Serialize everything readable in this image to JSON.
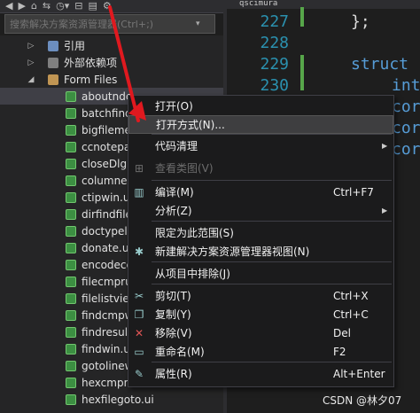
{
  "toolbar": {
    "sync_label": "⇆",
    "clock_label": "◷▾",
    "settings_label": "⚙"
  },
  "search": {
    "placeholder": "搜索解决方案资源管理器(Ctrl+;)"
  },
  "tree": {
    "ref_label": "引用",
    "external_label": "外部依赖项",
    "formfiles_label": "Form Files",
    "files": [
      "aboutndc",
      "batchfind",
      "bigfileme",
      "ccnotepa",
      "closeDlg.",
      "columnec",
      "ctipwin.ui",
      "dirfindfile",
      "doctypeli",
      "donate.ui",
      "encodecc",
      "filecmpru",
      "filelistview",
      "findcmpw",
      "findresult",
      "findwin.ui",
      "gotolinew",
      "hexcmpra",
      "hexfilegoto.ui"
    ]
  },
  "editor": {
    "tab_label": "qscimura",
    "line_numbers": [
      "227",
      "228",
      "229",
      "230"
    ],
    "code": [
      "};",
      "",
      "struct",
      "int"
    ],
    "side_fragments": [
      "cor",
      "cor",
      "cor"
    ]
  },
  "context_menu": {
    "items": [
      {
        "label": "打开(O)",
        "shortcut": "",
        "icon": "",
        "submenu": false,
        "disabled": false
      },
      {
        "label": "打开方式(N)...",
        "shortcut": "",
        "icon": "",
        "submenu": false,
        "disabled": false
      },
      {
        "label": "代码清理",
        "shortcut": "",
        "icon": "",
        "submenu": true,
        "disabled": false
      },
      {
        "label": "查看类图(V)",
        "shortcut": "",
        "icon": "class-diagram-icon",
        "submenu": false,
        "disabled": true
      },
      {
        "label": "编译(M)",
        "shortcut": "Ctrl+F7",
        "icon": "compile-icon",
        "submenu": false,
        "disabled": false
      },
      {
        "label": "分析(Z)",
        "shortcut": "",
        "icon": "",
        "submenu": true,
        "disabled": false
      },
      {
        "label": "限定为此范围(S)",
        "shortcut": "",
        "icon": "",
        "submenu": false,
        "disabled": false
      },
      {
        "label": "新建解决方案资源管理器视图(N)",
        "shortcut": "",
        "icon": "new-view-icon",
        "submenu": false,
        "disabled": false
      },
      {
        "label": "从项目中排除(J)",
        "shortcut": "",
        "icon": "",
        "submenu": false,
        "disabled": false
      },
      {
        "label": "剪切(T)",
        "shortcut": "Ctrl+X",
        "icon": "scissors-icon",
        "submenu": false,
        "disabled": false
      },
      {
        "label": "复制(Y)",
        "shortcut": "Ctrl+C",
        "icon": "copy-icon",
        "submenu": false,
        "disabled": false
      },
      {
        "label": "移除(V)",
        "shortcut": "Del",
        "icon": "remove-x-icon",
        "submenu": false,
        "disabled": false
      },
      {
        "label": "重命名(M)",
        "shortcut": "F2",
        "icon": "rename-icon",
        "submenu": false,
        "disabled": false
      },
      {
        "label": "属性(R)",
        "shortcut": "Alt+Enter",
        "icon": "wrench-icon",
        "submenu": false,
        "disabled": false
      }
    ]
  },
  "watermark": "CSDN @林夕07",
  "colors": {
    "arrow": "#e0191f",
    "selected_row": "#3f3f46",
    "menu_bg": "#1b1b1c",
    "line_number": "#2b91af",
    "keyword": "#569cd6"
  }
}
